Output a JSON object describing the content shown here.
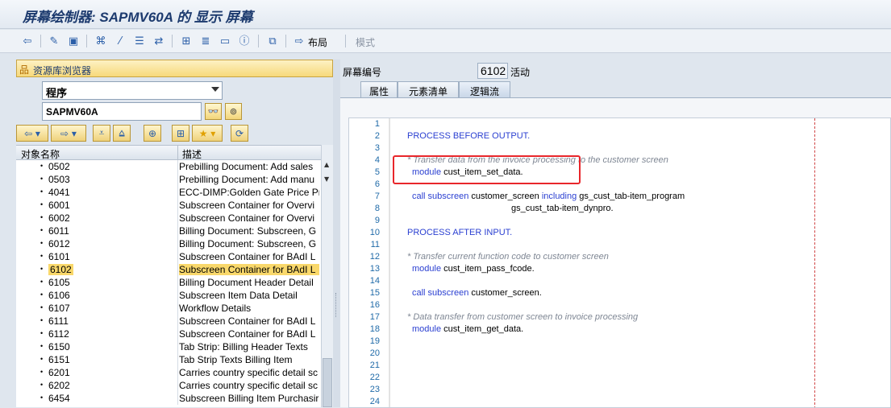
{
  "window": {
    "title": "屏幕绘制器: SAPMV60A 的 显示 屏幕"
  },
  "toolbar": {
    "layout_label": "布局",
    "mode_label": "模式"
  },
  "repo": {
    "header": "资源库浏览器",
    "type_value": "程序",
    "object_value": "SAPMV60A",
    "columns": {
      "name": "对象名称",
      "desc": "描述"
    },
    "rows": [
      {
        "name": "0502",
        "desc": "Prebilling Document: Add sales"
      },
      {
        "name": "0503",
        "desc": "Prebilling Document: Add manu"
      },
      {
        "name": "4041",
        "desc": "ECC-DIMP:Golden Gate Price Pr"
      },
      {
        "name": "6001",
        "desc": "Subscreen Container for Overvi"
      },
      {
        "name": "6002",
        "desc": "Subscreen Container for Overvi"
      },
      {
        "name": "6011",
        "desc": "Billing Document: Subscreen, G"
      },
      {
        "name": "6012",
        "desc": "Billing Document: Subscreen, G"
      },
      {
        "name": "6101",
        "desc": "Subscreen Container for BAdI L"
      },
      {
        "name": "6102",
        "desc": "Subscreen Container for BAdI L"
      },
      {
        "name": "6105",
        "desc": "Billing Document Header Detail"
      },
      {
        "name": "6106",
        "desc": "Subscreen Item Data Detail"
      },
      {
        "name": "6107",
        "desc": "Workflow Details"
      },
      {
        "name": "6111",
        "desc": "Subscreen Container for BAdI L"
      },
      {
        "name": "6112",
        "desc": "Subscreen Container for BAdI L"
      },
      {
        "name": "6150",
        "desc": "Tab Strip: Billing Header Texts"
      },
      {
        "name": "6151",
        "desc": "Tab Strip Texts Billing Item"
      },
      {
        "name": "6201",
        "desc": "Carries country specific detail sc"
      },
      {
        "name": "6202",
        "desc": "Carries country specific detail sc"
      },
      {
        "name": "6454",
        "desc": "Subscreen Billing Item Purchasir"
      }
    ],
    "selected": "6102"
  },
  "screen": {
    "label": "屏幕编号",
    "number": "6102",
    "status": "活动"
  },
  "tabs": [
    {
      "label": "属性"
    },
    {
      "label": "元素清单"
    },
    {
      "label": "逻辑流",
      "active": true
    }
  ],
  "code": {
    "line_numbers": [
      "1",
      "2",
      "3",
      "4",
      "5",
      "6",
      "7",
      "8",
      "9",
      "10",
      "11",
      "12",
      "13",
      "14",
      "15",
      "16",
      "17",
      "18",
      "19",
      "20",
      "21",
      "22",
      "23",
      "24"
    ],
    "l2": "PROCESS BEFORE OUTPUT.",
    "l4": "* Transfer data from the invoice processing to the customer screen",
    "l5_kw": "module",
    "l5_rest": " cust_item_set_data.",
    "l7_kw1": "call subscreen",
    "l7_mid": " customer_screen ",
    "l7_kw2": "including",
    "l7_rest": " gs_cust_tab-item_program",
    "l8": "gs_cust_tab-item_dynpro.",
    "l10": "PROCESS AFTER INPUT.",
    "l12": "* Transfer current function code to customer screen",
    "l13_kw": "module",
    "l13_rest": " cust_item_pass_fcode.",
    "l15_kw": "call subscreen",
    "l15_rest": " customer_screen.",
    "l17": "* Data transfer from customer screen to invoice processing",
    "l18_kw": "module",
    "l18_rest": " cust_item_get_data."
  },
  "colors": {
    "keyword": "#2a3fd1",
    "comment": "#7f8794",
    "highlight": "#e8262b",
    "selection": "#f9d86b"
  }
}
